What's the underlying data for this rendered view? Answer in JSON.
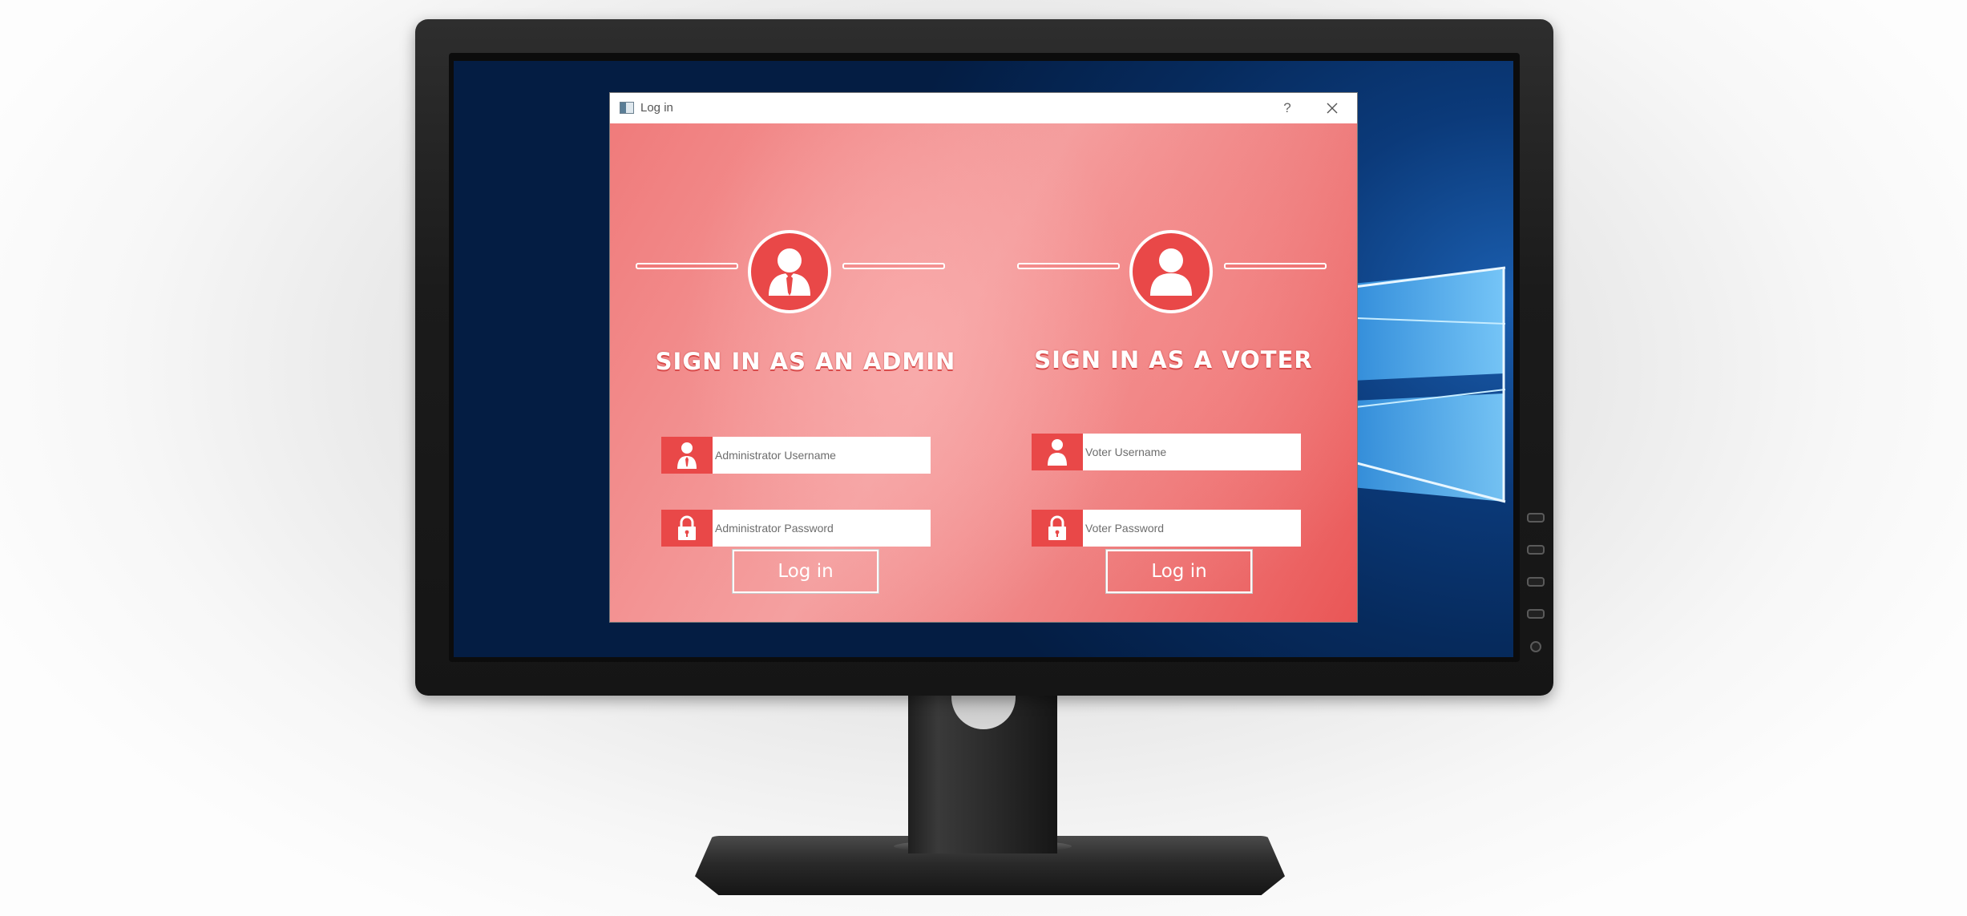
{
  "window": {
    "title": "Log in",
    "help_label": "?"
  },
  "admin": {
    "heading": "SIGN IN AS AN ADMIN",
    "username_placeholder": "Administrator Username",
    "password_placeholder": "Administrator Password",
    "login_label": "Log in",
    "avatar_icon": "admin-user-icon"
  },
  "voter": {
    "heading": "SIGN IN AS A VOTER",
    "username_placeholder": "Voter Username",
    "password_placeholder": "Voter Password",
    "login_label": "Log in",
    "avatar_icon": "voter-user-icon"
  },
  "colors": {
    "accent": "#e94848",
    "panel_light": "#f4a0a0",
    "panel_dark": "#ea5656",
    "desktop": "#0b3a7a"
  }
}
